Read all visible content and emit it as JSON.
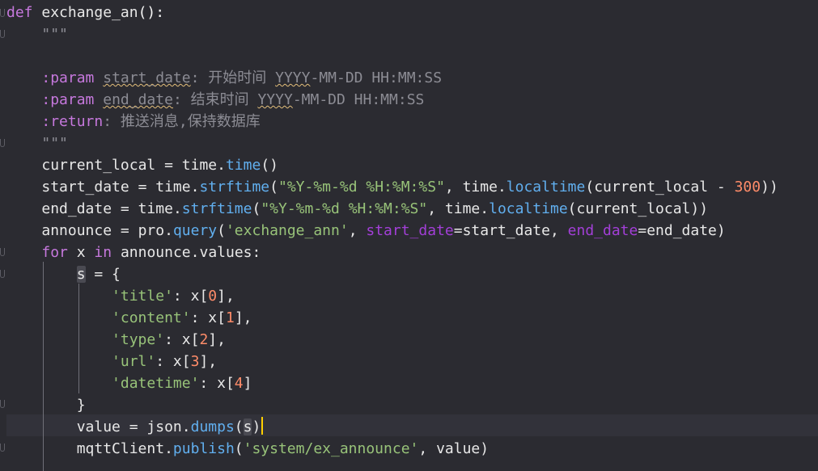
{
  "code": {
    "lines": [
      {
        "text": "def exchange_an():"
      },
      {
        "text": "    \"\"\""
      },
      {
        "text": ""
      },
      {
        "text": "    :param start_date: 开始时间 YYYY-MM-DD HH:MM:SS"
      },
      {
        "text": "    :param end_date: 结束时间 YYYY-MM-DD HH:MM:SS"
      },
      {
        "text": "    :return: 推送消息,保持数据库"
      },
      {
        "text": "    \"\"\""
      },
      {
        "text": "    current_local = time.time()"
      },
      {
        "text": "    start_date = time.strftime(\"%Y-%m-%d %H:%M:%S\", time.localtime(current_local - 300))"
      },
      {
        "text": "    end_date = time.strftime(\"%Y-%m-%d %H:%M:%S\", time.localtime(current_local))"
      },
      {
        "text": "    announce = pro.query('exchange_ann', start_date=start_date, end_date=end_date)"
      },
      {
        "text": "    for x in announce.values:"
      },
      {
        "text": "        s = {"
      },
      {
        "text": "            'title': x[0],"
      },
      {
        "text": "            'content': x[1],"
      },
      {
        "text": "            'type': x[2],"
      },
      {
        "text": "            'url': x[3],"
      },
      {
        "text": "            'datetime': x[4]"
      },
      {
        "text": "        }"
      },
      {
        "text": "        value = json.dumps(s)"
      },
      {
        "text": "        mqttClient.publish('system/ex_announce', value)"
      }
    ],
    "tokens": {
      "def": "def",
      "fn_name": "exchange_an",
      "parens_colon": "():",
      "docstring_quotes": "\"\"\"",
      "param_kw": ":param",
      "return_kw": ":return",
      "start_date": "start_date",
      "end_date": "end_date",
      "desc_start": ": 开始时间 ",
      "desc_end": ": 结束时间 ",
      "yyyy": "YYYY",
      "fmt_tail": "-MM-DD HH:MM:SS",
      "return_desc": ": 推送消息,保持数据库",
      "current_local": "current_local",
      "time": "time",
      "time_fn": "time",
      "strftime": "strftime",
      "localtime": "localtime",
      "fmt_str": "\"%Y-%m-%d %H:%M:%S\"",
      "num_300": "300",
      "announce": "announce",
      "pro": "pro",
      "query": "query",
      "exchange_ann_str": "'exchange_ann'",
      "kw_start_date": "start_date",
      "kw_end_date": "end_date",
      "for": "for",
      "in": "in",
      "x": "x",
      "values": "values",
      "s": "s",
      "title_str": "'title'",
      "content_str": "'content'",
      "type_str": "'type'",
      "url_str": "'url'",
      "datetime_str": "'datetime'",
      "n0": "0",
      "n1": "1",
      "n2": "2",
      "n3": "3",
      "n4": "4",
      "value": "value",
      "json": "json",
      "dumps": "dumps",
      "mqttClient": "mqttClient",
      "publish": "publish",
      "topic_str": "'system/ex_announce'"
    }
  },
  "colors": {
    "background": "#2b2b31",
    "keyword": "#c678dd",
    "function": "#61afef",
    "string": "#98c379",
    "number": "#ff8c69",
    "comment": "#8c8c94",
    "cursor": "#ffd000"
  }
}
